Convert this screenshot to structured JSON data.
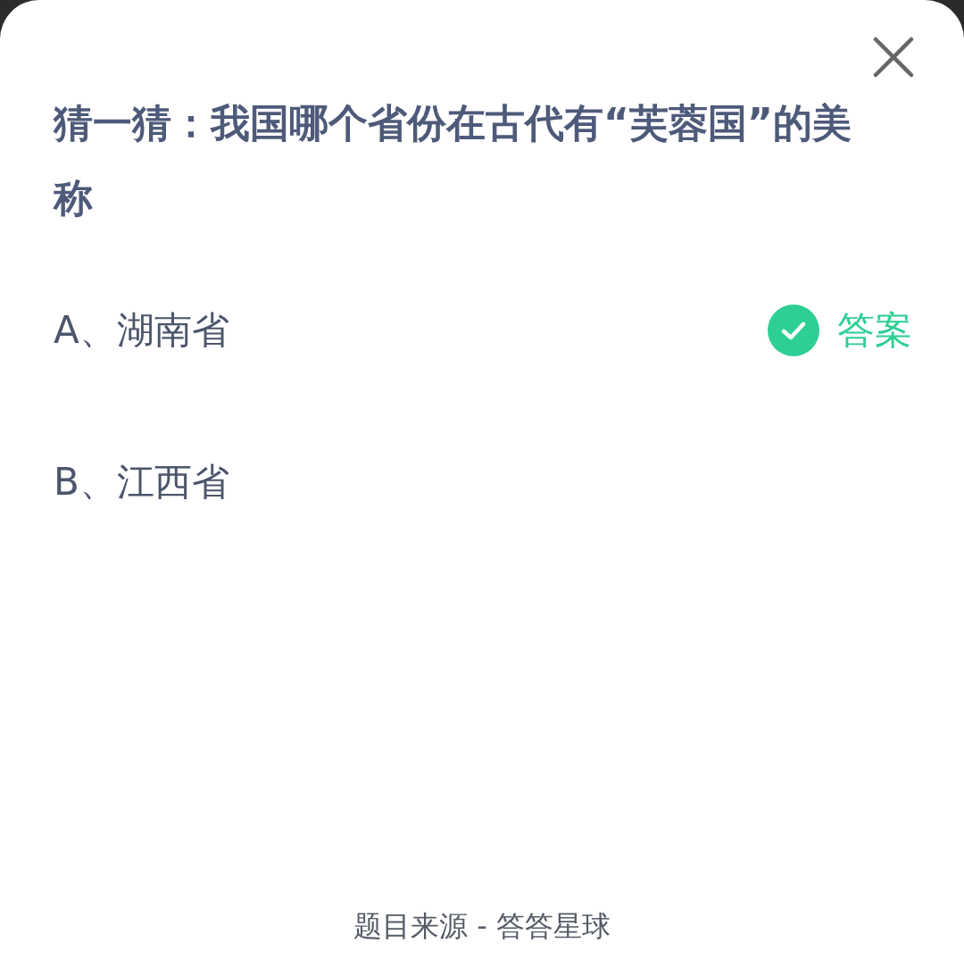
{
  "question": "猜一猜：我国哪个省份在古代有“芙蓉国”的美称",
  "options": [
    {
      "label": "A、湖南省",
      "correct": true,
      "answer_label": "答案"
    },
    {
      "label": "B、江西省",
      "correct": false
    }
  ],
  "footer": "题目来源 - 答答星球"
}
